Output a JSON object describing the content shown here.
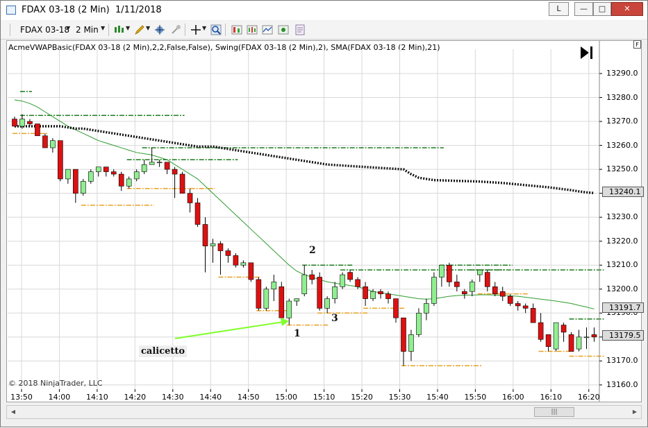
{
  "window": {
    "title": "FDAX 03-18 (2 Min)  1/11/2018",
    "buttons": {
      "workspace": "L",
      "minimize": "—",
      "maximize": "□",
      "close": "✕"
    }
  },
  "toolbar": {
    "instrument": "FDAX 03-18",
    "interval": "2 Min",
    "icons": [
      "bar-type-icon",
      "drawing-pencil-icon",
      "pointer-crosshair-icon",
      "magnifier-icon",
      "zoom-icon",
      "data-box-icon",
      "properties-icon",
      "indicators-icon",
      "strategies-icon",
      "templates-icon"
    ]
  },
  "chart": {
    "indicator_label": "AcmeVWAPBasic(FDAX 03-18 (2 Min),2,2,False,False), Swing(FDAX 03-18 (2 Min),2), SMA(FDAX 03-18 (2 Min),21)",
    "copyright": "© 2018 NinjaTrader, LLC",
    "f_marker": "F",
    "annotation_text": "calicetto",
    "wave_labels": [
      "1",
      "2",
      "3"
    ],
    "price_tags": [
      {
        "value": "13240.1",
        "kind": "vwap"
      },
      {
        "value": "13191.7",
        "kind": "sma"
      },
      {
        "value": "13179.5",
        "kind": "last"
      }
    ],
    "colors": {
      "up": "#90ee90",
      "down": "#dd1111",
      "sma": "#2e9b2e",
      "vwap": "#111111",
      "swing_high": "#1a7a1a",
      "swing_low": "#e8a020",
      "arrow": "#7fff2a"
    }
  },
  "chart_data": {
    "type": "candlestick",
    "title": "",
    "xlabel": "",
    "ylabel": "",
    "ylim": [
      13157,
      13297
    ],
    "y_ticks": [
      "13290.0",
      "13280.0",
      "13270.0",
      "13260.0",
      "13250.0",
      "13240.0",
      "13230.0",
      "13220.0",
      "13210.0",
      "13200.0",
      "13190.0",
      "13180.0",
      "13170.0",
      "13160.0"
    ],
    "x_ticks": [
      "13:50",
      "14:00",
      "14:10",
      "14:20",
      "14:30",
      "14:40",
      "14:50",
      "15:00",
      "15:10",
      "15:20",
      "15:30",
      "15:40",
      "15:50",
      "16:00",
      "16:10",
      "16:20"
    ],
    "candles": [
      {
        "o": 13271,
        "h": 13272,
        "l": 13268,
        "c": 13268
      },
      {
        "o": 13268,
        "h": 13273,
        "l": 13267,
        "c": 13271
      },
      {
        "o": 13270,
        "h": 13271,
        "l": 13268,
        "c": 13269
      },
      {
        "o": 13269,
        "h": 13269,
        "l": 13264,
        "c": 13264
      },
      {
        "o": 13264,
        "h": 13265,
        "l": 13259,
        "c": 13259
      },
      {
        "o": 13259,
        "h": 13263,
        "l": 13257,
        "c": 13262
      },
      {
        "o": 13262,
        "h": 13262,
        "l": 13245,
        "c": 13246
      },
      {
        "o": 13246,
        "h": 13250,
        "l": 13244,
        "c": 13250
      },
      {
        "o": 13250,
        "h": 13250,
        "l": 13236,
        "c": 13240
      },
      {
        "o": 13240,
        "h": 13246,
        "l": 13239,
        "c": 13245
      },
      {
        "o": 13245,
        "h": 13250,
        "l": 13244,
        "c": 13249
      },
      {
        "o": 13249,
        "h": 13251,
        "l": 13247,
        "c": 13251
      },
      {
        "o": 13251,
        "h": 13251,
        "l": 13247,
        "c": 13249
      },
      {
        "o": 13249,
        "h": 13250,
        "l": 13247,
        "c": 13248
      },
      {
        "o": 13248,
        "h": 13249,
        "l": 13241,
        "c": 13243
      },
      {
        "o": 13243,
        "h": 13247,
        "l": 13242,
        "c": 13246
      },
      {
        "o": 13246,
        "h": 13250,
        "l": 13245,
        "c": 13249
      },
      {
        "o": 13249,
        "h": 13254,
        "l": 13248,
        "c": 13252
      },
      {
        "o": 13252,
        "h": 13259,
        "l": 13252,
        "c": 13253
      },
      {
        "o": 13253,
        "h": 13254,
        "l": 13251,
        "c": 13253
      },
      {
        "o": 13253,
        "h": 13253,
        "l": 13248,
        "c": 13250
      },
      {
        "o": 13250,
        "h": 13251,
        "l": 13238,
        "c": 13248
      },
      {
        "o": 13248,
        "h": 13249,
        "l": 13240,
        "c": 13240
      },
      {
        "o": 13240,
        "h": 13242,
        "l": 13232,
        "c": 13236
      },
      {
        "o": 13236,
        "h": 13238,
        "l": 13226,
        "c": 13227
      },
      {
        "o": 13227,
        "h": 13230,
        "l": 13207,
        "c": 13218
      },
      {
        "o": 13218,
        "h": 13221,
        "l": 13211,
        "c": 13219
      },
      {
        "o": 13219,
        "h": 13220,
        "l": 13206,
        "c": 13216
      },
      {
        "o": 13216,
        "h": 13217,
        "l": 13211,
        "c": 13214
      },
      {
        "o": 13214,
        "h": 13215,
        "l": 13209,
        "c": 13210
      },
      {
        "o": 13210,
        "h": 13212,
        "l": 13209,
        "c": 13211
      },
      {
        "o": 13211,
        "h": 13211,
        "l": 13203,
        "c": 13204
      },
      {
        "o": 13204,
        "h": 13205,
        "l": 13191,
        "c": 13192
      },
      {
        "o": 13192,
        "h": 13201,
        "l": 13191,
        "c": 13200
      },
      {
        "o": 13200,
        "h": 13206,
        "l": 13195,
        "c": 13203
      },
      {
        "o": 13201,
        "h": 13203,
        "l": 13188,
        "c": 13188
      },
      {
        "o": 13188,
        "h": 13196,
        "l": 13185,
        "c": 13195
      },
      {
        "o": 13195,
        "h": 13196,
        "l": 13193,
        "c": 13196
      },
      {
        "o": 13198,
        "h": 13210,
        "l": 13197,
        "c": 13206
      },
      {
        "o": 13206,
        "h": 13208,
        "l": 13202,
        "c": 13204
      },
      {
        "o": 13205,
        "h": 13207,
        "l": 13191,
        "c": 13192
      },
      {
        "o": 13192,
        "h": 13197,
        "l": 13190,
        "c": 13196
      },
      {
        "o": 13196,
        "h": 13203,
        "l": 13194,
        "c": 13201
      },
      {
        "o": 13201,
        "h": 13207,
        "l": 13200,
        "c": 13206
      },
      {
        "o": 13207,
        "h": 13208,
        "l": 13203,
        "c": 13204
      },
      {
        "o": 13204,
        "h": 13205,
        "l": 13200,
        "c": 13201
      },
      {
        "o": 13201,
        "h": 13203,
        "l": 13193,
        "c": 13196
      },
      {
        "o": 13196,
        "h": 13200,
        "l": 13195,
        "c": 13199
      },
      {
        "o": 13199,
        "h": 13200,
        "l": 13196,
        "c": 13198
      },
      {
        "o": 13198,
        "h": 13199,
        "l": 13194,
        "c": 13196
      },
      {
        "o": 13196,
        "h": 13196,
        "l": 13186,
        "c": 13188
      },
      {
        "o": 13188,
        "h": 13188,
        "l": 13168,
        "c": 13174
      },
      {
        "o": 13174,
        "h": 13183,
        "l": 13170,
        "c": 13181
      },
      {
        "o": 13181,
        "h": 13192,
        "l": 13180,
        "c": 13190
      },
      {
        "o": 13190,
        "h": 13196,
        "l": 13187,
        "c": 13194
      },
      {
        "o": 13194,
        "h": 13207,
        "l": 13193,
        "c": 13205
      },
      {
        "o": 13205,
        "h": 13210,
        "l": 13201,
        "c": 13210
      },
      {
        "o": 13210,
        "h": 13211,
        "l": 13201,
        "c": 13203
      },
      {
        "o": 13203,
        "h": 13206,
        "l": 13199,
        "c": 13201
      },
      {
        "o": 13199,
        "h": 13200,
        "l": 13196,
        "c": 13198
      },
      {
        "o": 13199,
        "h": 13204,
        "l": 13197,
        "c": 13203
      },
      {
        "o": 13206,
        "h": 13208,
        "l": 13203,
        "c": 13208
      },
      {
        "o": 13207,
        "h": 13208,
        "l": 13199,
        "c": 13201
      },
      {
        "o": 13201,
        "h": 13203,
        "l": 13197,
        "c": 13198
      },
      {
        "o": 13199,
        "h": 13201,
        "l": 13195,
        "c": 13197
      },
      {
        "o": 13197,
        "h": 13198,
        "l": 13193,
        "c": 13194
      },
      {
        "o": 13194,
        "h": 13195,
        "l": 13191,
        "c": 13193
      },
      {
        "o": 13193,
        "h": 13194,
        "l": 13190,
        "c": 13192
      },
      {
        "o": 13192,
        "h": 13194,
        "l": 13186,
        "c": 13186
      },
      {
        "o": 13186,
        "h": 13190,
        "l": 13178,
        "c": 13179
      },
      {
        "o": 13181,
        "h": 13181,
        "l": 13174,
        "c": 13176
      },
      {
        "o": 13175,
        "h": 13186,
        "l": 13174,
        "c": 13186
      },
      {
        "o": 13185,
        "h": 13186,
        "l": 13178,
        "c": 13182
      },
      {
        "o": 13181,
        "h": 13182,
        "l": 13174,
        "c": 13174
      },
      {
        "o": 13175,
        "h": 13183,
        "l": 13174,
        "c": 13180
      },
      {
        "o": 13180,
        "h": 13184,
        "l": 13175,
        "c": 13180
      },
      {
        "o": 13181,
        "h": 13184,
        "l": 13178,
        "c": 13180
      }
    ],
    "vwap": [
      13268,
      13268,
      13268,
      13268,
      13268,
      13268,
      13268,
      13267.5,
      13267,
      13267,
      13266.5,
      13266,
      13265.5,
      13265,
      13264.5,
      13264,
      13263.5,
      13263,
      13262.5,
      13262,
      13261.5,
      13261,
      13260.5,
      13260,
      13259.5,
      13259.5,
      13259.5,
      13259,
      13258.5,
      13258,
      13257.5,
      13257,
      13256.5,
      13256,
      13255.5,
      13255,
      13254.5,
      13254,
      13253.5,
      13253,
      13252.5,
      13252,
      13251.8,
      13251.6,
      13251.4,
      13251.2,
      13251,
      13250.8,
      13250.6,
      13250.4,
      13250.2,
      13250,
      13248,
      13246.5,
      13246,
      13245.5,
      13245.4,
      13245.3,
      13245.2,
      13245.1,
      13245,
      13244.9,
      13244.7,
      13244.5,
      13244.3,
      13244,
      13243.7,
      13243.4,
      13243.1,
      13242.8,
      13242.5,
      13242.1,
      13241.7,
      13241.3,
      13240.8,
      13240.4,
      13240.1
    ],
    "sma": [
      13279,
      13278.5,
      13277.5,
      13276,
      13274,
      13272,
      13270,
      13268,
      13266.5,
      13265,
      13263.5,
      13262,
      13261,
      13260,
      13259,
      13258,
      13257,
      13256.5,
      13256,
      13255,
      13254,
      13252,
      13250,
      13248,
      13246,
      13243,
      13240,
      13237,
      13234,
      13231,
      13228,
      13225,
      13222,
      13219,
      13216,
      13213,
      13210,
      13207.5,
      13206,
      13205,
      13204,
      13203,
      13202.5,
      13202,
      13201.5,
      13201,
      13200,
      13199,
      13198.5,
      13198,
      13197.5,
      13197,
      13196.5,
      13196,
      13195.8,
      13196,
      13196.5,
      13197,
      13197.3,
      13197.5,
      13197.5,
      13197.6,
      13197.6,
      13197.5,
      13197.4,
      13197.2,
      13197,
      13196.6,
      13196.2,
      13195.8,
      13195.4,
      13195,
      13194.5,
      13194,
      13193.2,
      13192.5,
      13191.7
    ],
    "swing_highs": [
      {
        "price": 13272.5,
        "from": 1,
        "to": 22
      },
      {
        "price": 13254,
        "from": 15,
        "to": 29
      },
      {
        "price": 13259,
        "from": 17,
        "to": 56
      },
      {
        "price": 13210,
        "from": 38,
        "to": 44
      },
      {
        "price": 13208,
        "from": 43,
        "to": 64
      },
      {
        "price": 13210,
        "from": 56,
        "to": 65
      },
      {
        "price": 13208,
        "from": 60,
        "to": 77
      },
      {
        "price": 13187.5,
        "from": 73,
        "to": 77
      },
      {
        "price": 13282.5,
        "from": 1,
        "to": 2
      }
    ],
    "swing_lows": [
      {
        "price": 13265,
        "from": 0,
        "to": 4
      },
      {
        "price": 13235,
        "from": 9,
        "to": 18
      },
      {
        "price": 13242,
        "from": 15,
        "to": 26
      },
      {
        "price": 13205,
        "from": 27,
        "to": 32
      },
      {
        "price": 13191,
        "from": 32,
        "to": 36
      },
      {
        "price": 13185,
        "from": 36,
        "to": 41
      },
      {
        "price": 13190,
        "from": 40,
        "to": 46
      },
      {
        "price": 13192,
        "from": 46,
        "to": 51
      },
      {
        "price": 13168,
        "from": 51,
        "to": 61
      },
      {
        "price": 13198,
        "from": 61,
        "to": 67
      },
      {
        "price": 13174,
        "from": 69,
        "to": 73
      },
      {
        "price": 13172,
        "from": 73,
        "to": 77
      }
    ]
  }
}
